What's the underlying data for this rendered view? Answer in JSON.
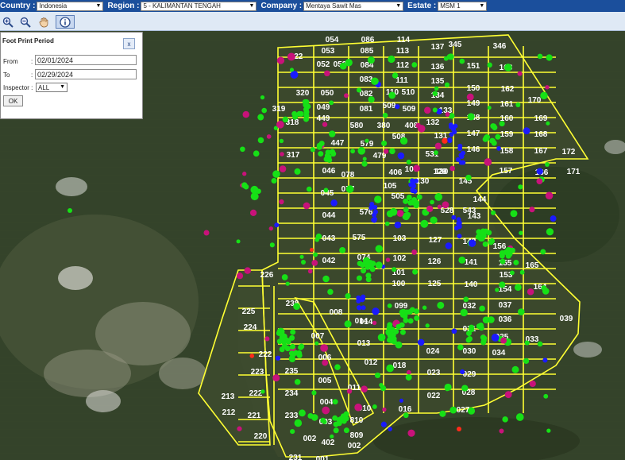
{
  "filters": {
    "country": {
      "label": "Country :",
      "value": "Indonesia"
    },
    "region": {
      "label": "Region :",
      "value": "5 - KALIMANTAN TENGAH"
    },
    "company": {
      "label": "Company :",
      "value": "Mentaya Sawit Mas"
    },
    "estate": {
      "label": "Estate :",
      "value": "MSM 1"
    }
  },
  "toolbar": [
    {
      "icon": "zoom-in-icon"
    },
    {
      "icon": "zoom-out-icon"
    },
    {
      "icon": "pan-hand-icon"
    },
    {
      "icon": "info-icon"
    }
  ],
  "footprint_panel": {
    "title": "Foot Print Period",
    "close_label": "x",
    "from_label": "From",
    "from_value": "02/01/2024",
    "to_label": "To",
    "to_value": "02/29/2024",
    "inspector_label": "Inspector :",
    "inspector_value": "ALL",
    "ok_label": "OK"
  },
  "colors": {
    "boundary": "#ffff33",
    "point_green": "#16e016",
    "point_magenta": "#c8127a",
    "point_blue": "#1a1aff",
    "point_red": "#ff2a1a",
    "topbar": "#1b4f9c"
  },
  "map": {
    "block_labels": [
      "054",
      "086",
      "114",
      "345",
      "346",
      "322",
      "053",
      "085",
      "113",
      "137",
      "052",
      "052",
      "084",
      "112",
      "136",
      "151",
      "163",
      "083",
      "111",
      "135",
      "150",
      "162",
      "170",
      "320",
      "050",
      "082",
      "110",
      "510",
      "134",
      "149",
      "161",
      "319",
      "049",
      "081",
      "509",
      "509",
      "133",
      "148",
      "160",
      "169",
      "449",
      "580",
      "380",
      "408",
      "132",
      "147",
      "159",
      "168",
      "318",
      "447",
      "579",
      "508",
      "131",
      "146",
      "158",
      "167",
      "172",
      "317",
      "479",
      "531",
      "130",
      "145",
      "157",
      "166",
      "171",
      "046",
      "078",
      "406",
      "106",
      "129",
      "045",
      "077",
      "105",
      "130",
      "144",
      "576",
      "528",
      "543",
      "143",
      "044",
      "505",
      "142",
      "156",
      "043",
      "575",
      "103",
      "127",
      "141",
      "042",
      "074",
      "102",
      "126",
      "155",
      "165",
      "101",
      "140",
      "153",
      "226",
      "100",
      "125",
      "154",
      "164",
      "238",
      "032",
      "037",
      "225",
      "008",
      "099",
      "031",
      "036",
      "039",
      "224",
      "014",
      "014",
      "035",
      "033",
      "007",
      "013",
      "024",
      "030",
      "222",
      "006",
      "012",
      "034",
      "223",
      "235",
      "018",
      "029",
      "005",
      "011",
      "023",
      "028",
      "213",
      "222",
      "234",
      "004",
      "010",
      "022",
      "027",
      "212",
      "221",
      "233",
      "003",
      "810",
      "016",
      "220",
      "002",
      "809",
      "402",
      "002",
      "231",
      "001"
    ]
  }
}
